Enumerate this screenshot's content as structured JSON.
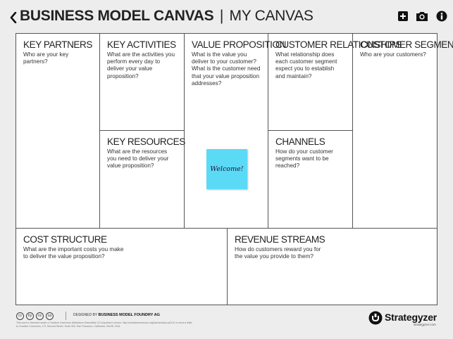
{
  "header": {
    "back_icon": "chevron-left-icon",
    "title": "BUSINESS MODEL CANVAS",
    "separator": "|",
    "canvas_name": "MY CANVAS",
    "actions": [
      {
        "icon": "add-square-icon"
      },
      {
        "icon": "camera-icon"
      },
      {
        "icon": "info-icon"
      }
    ]
  },
  "canvas": {
    "key_partners": {
      "title": "KEY PARTNERS",
      "prompt": "Who are your key partners?"
    },
    "key_activities": {
      "title": "KEY ACTIVITIES",
      "prompt": "What are the activities you perform every day to deliver your value proposition?"
    },
    "key_resources": {
      "title": "KEY RESOURCES",
      "prompt": "What are the resources you need to deliver your value proposition?"
    },
    "value_proposition": {
      "title": "VALUE PROPOSITION",
      "prompt": "What is the value you deliver to your customer? What is the customer need that your value proposition addresses?"
    },
    "customer_relationships": {
      "title": "CUSTOMER RELATIONSHIPS",
      "prompt": "What relationship does each customer segment expect you to establish and maintain?"
    },
    "channels": {
      "title": "CHANNELS",
      "prompt": "How do your customer segments want to be reached?"
    },
    "customer_segments": {
      "title": "CUSTOMER SEGMENTS",
      "prompt": "Who are your customers?"
    },
    "cost_structure": {
      "title": "COST STRUCTURE",
      "prompt": "What are the important costs you make to deliver the value proposition?"
    },
    "revenue_streams": {
      "title": "REVENUE STREAMS",
      "prompt": "How do customers reward you for the value you provide to them?"
    },
    "sticky_note": {
      "text": "Welcome!",
      "color": "#5bdaf6"
    }
  },
  "footer": {
    "license_icons": [
      "cc",
      "by",
      "nc",
      "sa"
    ],
    "designed_by_prefix": "DESIGNED BY",
    "designed_by": "BUSINESS MODEL FOUNDRY AG",
    "license_text": "This work is licensed under a Creative Commons Attribution-ShareAlike 3.0 Unported License. http://creativecommons.org/licenses/by-sa/3.0/ or send a letter to Creative Commons, 171 Second Street, Suite 300, San Francisco, California, 94105, USA.",
    "brand": "Strategyzer",
    "brand_url": "strategyzer.com"
  }
}
